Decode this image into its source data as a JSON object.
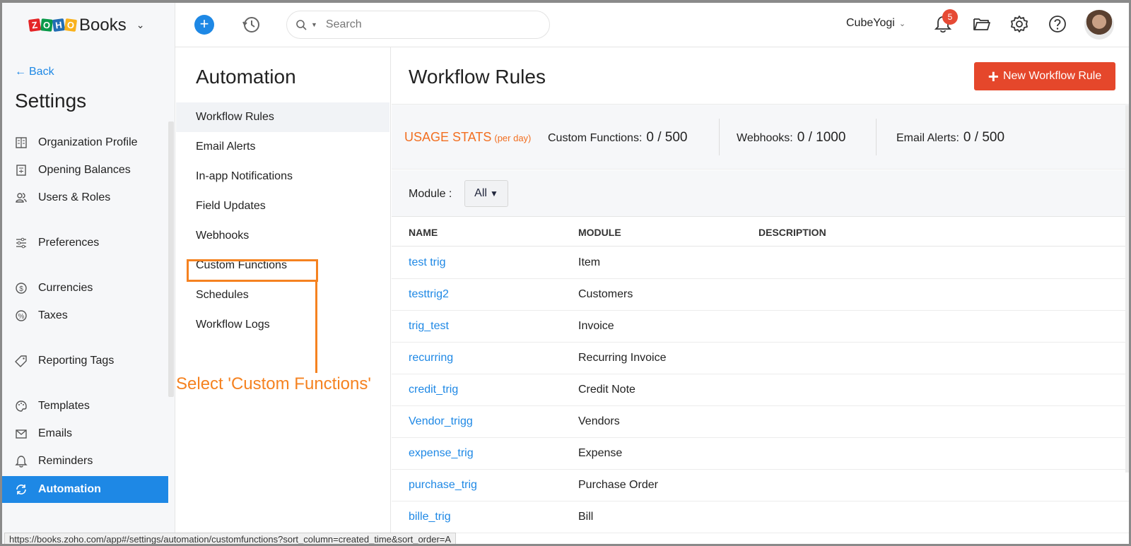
{
  "brand": {
    "logo_letters": [
      "Z",
      "O",
      "H",
      "O"
    ],
    "name": "Books"
  },
  "search": {
    "placeholder": "Search"
  },
  "header": {
    "org_name": "CubeYogi",
    "notification_count": "5"
  },
  "sidebar": {
    "back_label": "Back",
    "title": "Settings",
    "items": [
      {
        "label": "Organization Profile",
        "icon": "building-icon"
      },
      {
        "label": "Opening Balances",
        "icon": "ledger-icon"
      },
      {
        "label": "Users & Roles",
        "icon": "users-icon"
      },
      {
        "label": "Preferences",
        "icon": "sliders-icon"
      },
      {
        "label": "Currencies",
        "icon": "currency-icon"
      },
      {
        "label": "Taxes",
        "icon": "percent-icon"
      },
      {
        "label": "Reporting Tags",
        "icon": "tag-icon"
      },
      {
        "label": "Templates",
        "icon": "palette-icon"
      },
      {
        "label": "Emails",
        "icon": "mail-icon"
      },
      {
        "label": "Reminders",
        "icon": "bell-icon"
      },
      {
        "label": "Automation",
        "icon": "refresh-icon",
        "active": true
      }
    ]
  },
  "automation": {
    "title": "Automation",
    "items": [
      {
        "label": "Workflow Rules",
        "active": true
      },
      {
        "label": "Email Alerts"
      },
      {
        "label": "In-app Notifications"
      },
      {
        "label": "Field Updates"
      },
      {
        "label": "Webhooks"
      },
      {
        "label": "Custom Functions"
      },
      {
        "label": "Schedules"
      },
      {
        "label": "Workflow Logs"
      }
    ],
    "callout": "Select 'Custom Functions'"
  },
  "main": {
    "title": "Workflow Rules",
    "new_button": "New Workflow Rule",
    "usage": {
      "label": "USAGE STATS",
      "sub": "(per day)",
      "custom_functions_label": "Custom Functions:",
      "custom_functions_value": "0 / 500",
      "webhooks_label": "Webhooks:",
      "webhooks_value": "0 / 1000",
      "email_alerts_label": "Email Alerts:",
      "email_alerts_value": "0 / 500"
    },
    "module_filter": {
      "label": "Module :",
      "value": "All"
    },
    "columns": [
      "NAME",
      "MODULE",
      "DESCRIPTION"
    ],
    "rows": [
      {
        "name": "test trig",
        "module": "Item"
      },
      {
        "name": "testtrig2",
        "module": "Customers"
      },
      {
        "name": "trig_test",
        "module": "Invoice"
      },
      {
        "name": "recurring",
        "module": "Recurring Invoice"
      },
      {
        "name": "credit_trig",
        "module": "Credit Note"
      },
      {
        "name": "Vendor_trigg",
        "module": "Vendors"
      },
      {
        "name": "expense_trig",
        "module": "Expense"
      },
      {
        "name": "purchase_trig",
        "module": "Purchase Order"
      },
      {
        "name": "bille_trig",
        "module": "Bill"
      }
    ]
  },
  "status_bar": {
    "url": "https://books.zoho.com/app#/settings/automation/customfunctions?sort_column=created_time&sort_order=A"
  },
  "colors": {
    "accent": "#1e88e5",
    "primary_button": "#e5472b",
    "usage_label": "#f26f21",
    "callout": "#f58220"
  }
}
